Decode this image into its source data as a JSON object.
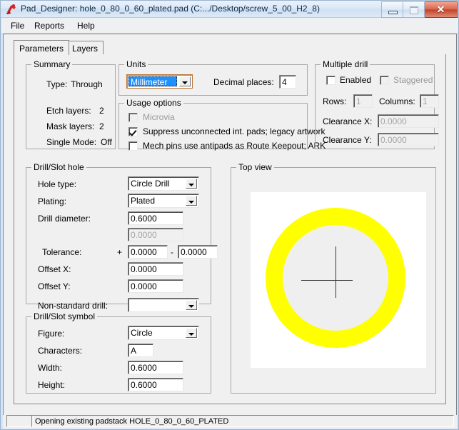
{
  "window": {
    "title": "Pad_Designer: hole_0_80_0_60_plated.pad (C:.../Desktop/screw_5_00_H2_8)",
    "app_icon": "pad-designer-icon",
    "minimize_label": "",
    "maximize_label": "",
    "close_label": "✕"
  },
  "menu": {
    "items": [
      {
        "label": "File"
      },
      {
        "label": "Reports"
      },
      {
        "label": "Help"
      }
    ]
  },
  "tabs": [
    {
      "label": "Parameters",
      "active": true
    },
    {
      "label": "Layers",
      "active": false
    }
  ],
  "summary": {
    "title": "Summary",
    "type_label": "Type:",
    "type_value": "Through",
    "etch_label": "Etch layers:",
    "etch_value": "2",
    "mask_label": "Mask layers:",
    "mask_value": "2",
    "single_label": "Single Mode:",
    "single_value": "Off"
  },
  "units": {
    "title": "Units",
    "selected": "Millimeter",
    "decimal_label": "Decimal places:",
    "decimal_value": "4"
  },
  "usage": {
    "title": "Usage options",
    "microvia_label": "Microvia",
    "microvia_checked": false,
    "microvia_disabled": true,
    "suppress_label": "Suppress unconnected int. pads; legacy artwork",
    "suppress_checked": true,
    "mech_label": "Mech pins use antipads as Route Keepout; ARK",
    "mech_checked": false
  },
  "multiple_drill": {
    "title": "Multiple drill",
    "enabled_label": "Enabled",
    "enabled_checked": false,
    "staggered_label": "Staggered",
    "staggered_checked": false,
    "staggered_disabled": true,
    "rows_label": "Rows:",
    "rows_value": "1",
    "columns_label": "Columns:",
    "columns_value": "1",
    "clearance_x_label": "Clearance X:",
    "clearance_x_value": "0.0000",
    "clearance_y_label": "Clearance Y:",
    "clearance_y_value": "0.0000"
  },
  "drill_hole": {
    "title": "Drill/Slot hole",
    "hole_type_label": "Hole type:",
    "hole_type_value": "Circle Drill",
    "plating_label": "Plating:",
    "plating_value": "Plated",
    "diameter_label": "Drill diameter:",
    "diameter_value": "0.6000",
    "diameter2_value": "0.0000",
    "tolerance_label": "Tolerance:",
    "tolerance_plus_sign": "+",
    "tolerance_plus_value": "0.0000",
    "tolerance_dash": "-",
    "tolerance_minus_value": "0.0000",
    "offset_x_label": "Offset X:",
    "offset_x_value": "0.0000",
    "offset_y_label": "Offset Y:",
    "offset_y_value": "0.0000",
    "nonstandard_label": "Non-standard drill:",
    "nonstandard_value": ""
  },
  "drill_symbol": {
    "title": "Drill/Slot symbol",
    "figure_label": "Figure:",
    "figure_value": "Circle",
    "characters_label": "Characters:",
    "characters_value": "A",
    "width_label": "Width:",
    "width_value": "0.6000",
    "height_label": "Height:",
    "height_value": "0.6000"
  },
  "top_view": {
    "title": "Top view",
    "pad_color": "#ffff00",
    "canvas_color": "#ffffff",
    "hole_color": "#efefef",
    "crosshair_color": "#333333"
  },
  "statusbar": {
    "left_pane": "",
    "message": "Opening existing padstack HOLE_0_80_0_60_PLATED"
  },
  "colors": {
    "dialog_bg": "#f0f0f0",
    "title_accent": "#cfe0f2",
    "close_red": "#c0452c",
    "combo_highlight": "#1e90ff"
  }
}
